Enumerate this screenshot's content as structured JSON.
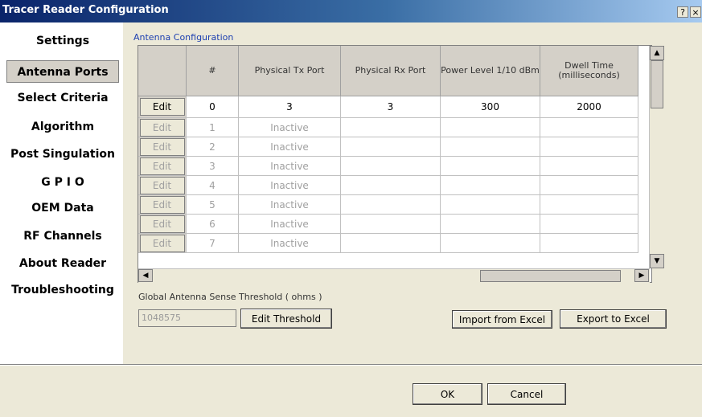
{
  "window": {
    "title": "Tracer Reader Configuration",
    "help_glyph": "?",
    "close_glyph": "×"
  },
  "sidebar": {
    "items": [
      {
        "label": "Settings"
      },
      {
        "label": "Antenna Ports",
        "selected": true
      },
      {
        "label": "Select Criteria"
      },
      {
        "label": "Algorithm"
      },
      {
        "label": "Post Singulation"
      },
      {
        "label": "G P I O"
      },
      {
        "label": "OEM Data"
      },
      {
        "label": "RF Channels"
      },
      {
        "label": "About Reader"
      },
      {
        "label": "Troubleshooting"
      }
    ]
  },
  "main": {
    "section_title": "Antenna Configuration",
    "grid": {
      "columns": [
        "",
        "#",
        "Physical Tx Port",
        "Physical Rx Port",
        "Power Level 1/10 dBm",
        "Dwell Time (milliseconds)"
      ],
      "rows": [
        {
          "edit": "Edit",
          "num": "0",
          "tx": "3",
          "rx": "3",
          "power": "300",
          "dwell": "2000",
          "active": true
        },
        {
          "edit": "Edit",
          "num": "1",
          "tx": "Inactive",
          "rx": "",
          "power": "",
          "dwell": "",
          "active": false
        },
        {
          "edit": "Edit",
          "num": "2",
          "tx": "Inactive",
          "rx": "",
          "power": "",
          "dwell": "",
          "active": false
        },
        {
          "edit": "Edit",
          "num": "3",
          "tx": "Inactive",
          "rx": "",
          "power": "",
          "dwell": "",
          "active": false
        },
        {
          "edit": "Edit",
          "num": "4",
          "tx": "Inactive",
          "rx": "",
          "power": "",
          "dwell": "",
          "active": false
        },
        {
          "edit": "Edit",
          "num": "5",
          "tx": "Inactive",
          "rx": "",
          "power": "",
          "dwell": "",
          "active": false
        },
        {
          "edit": "Edit",
          "num": "6",
          "tx": "Inactive",
          "rx": "",
          "power": "",
          "dwell": "",
          "active": false
        },
        {
          "edit": "Edit",
          "num": "7",
          "tx": "Inactive",
          "rx": "",
          "power": "",
          "dwell": "",
          "active": false
        }
      ]
    },
    "threshold_label": "Global Antenna Sense Threshold ( ohms )",
    "threshold_value": "1048575",
    "edit_threshold_label": "Edit Threshold",
    "import_label": "Import from Excel",
    "export_label": "Export to Excel"
  },
  "footer": {
    "ok_label": "OK",
    "cancel_label": "Cancel"
  }
}
